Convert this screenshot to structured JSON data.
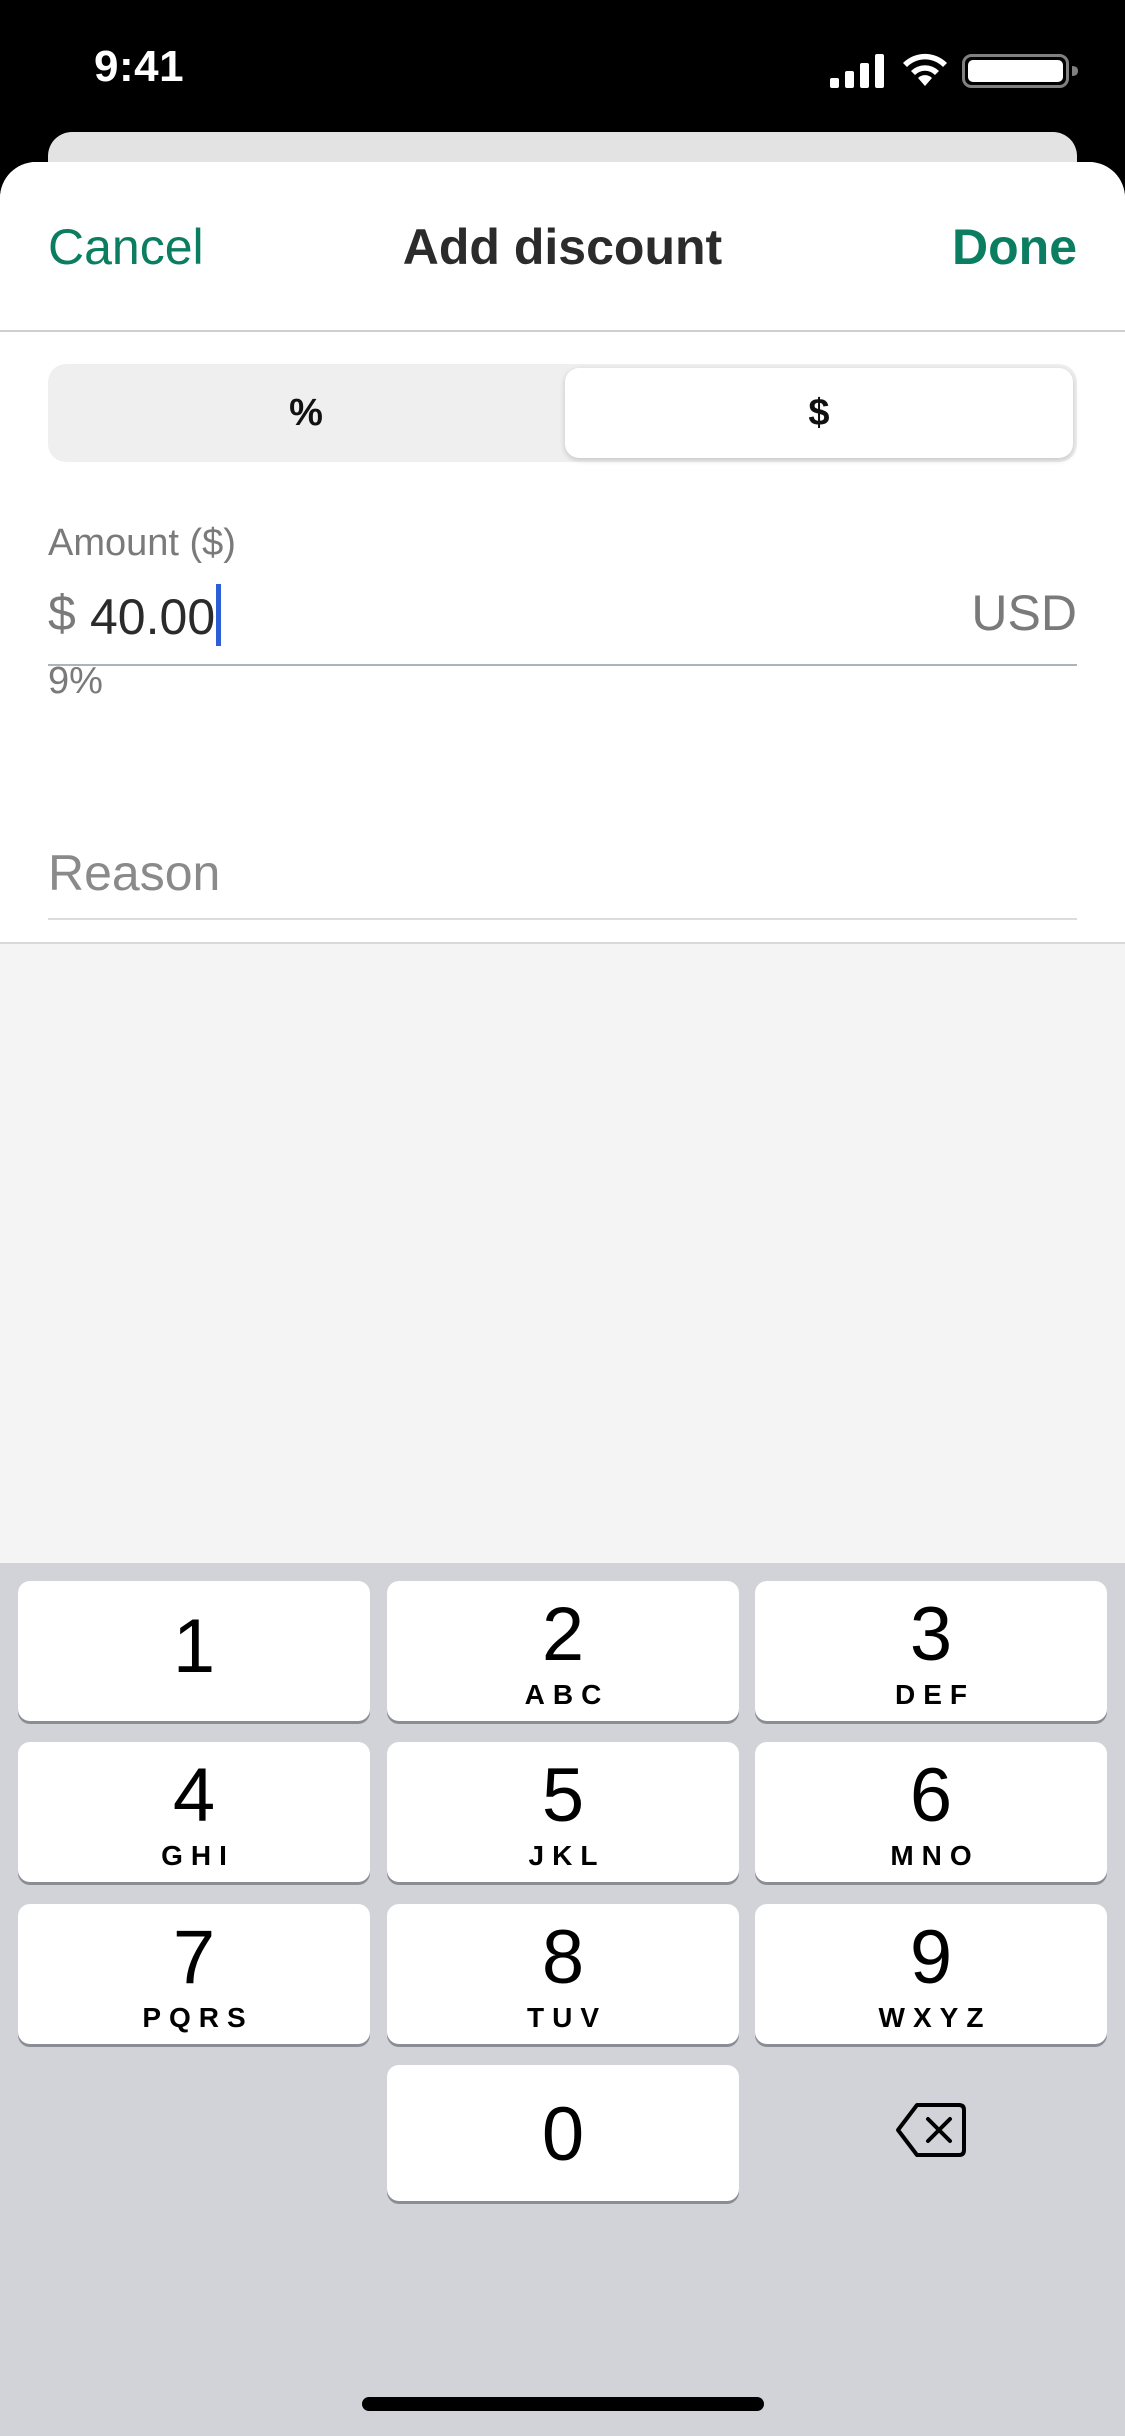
{
  "status_bar": {
    "time": "9:41"
  },
  "nav": {
    "cancel": "Cancel",
    "title": "Add discount",
    "done": "Done"
  },
  "segmented": {
    "options": [
      "%",
      "$"
    ],
    "selected": "$"
  },
  "amount": {
    "label": "Amount ($)",
    "prefix": "$",
    "value": "40.00",
    "suffix": "USD",
    "percent_hint": "9%"
  },
  "reason": {
    "placeholder": "Reason",
    "value": ""
  },
  "keypad": {
    "keys": [
      {
        "digit": "1",
        "letters": ""
      },
      {
        "digit": "2",
        "letters": "ABC"
      },
      {
        "digit": "3",
        "letters": "DEF"
      },
      {
        "digit": "4",
        "letters": "GHI"
      },
      {
        "digit": "5",
        "letters": "JKL"
      },
      {
        "digit": "6",
        "letters": "MNO"
      },
      {
        "digit": "7",
        "letters": "PQRS"
      },
      {
        "digit": "8",
        "letters": "TUV"
      },
      {
        "digit": "9",
        "letters": "WXYZ"
      },
      {
        "digit": "0",
        "letters": ""
      }
    ],
    "backspace_icon": "backspace-icon"
  },
  "colors": {
    "accent": "#0b7d61",
    "caret": "#2c5ed8",
    "keypad_bg": "#d1d3d9"
  }
}
